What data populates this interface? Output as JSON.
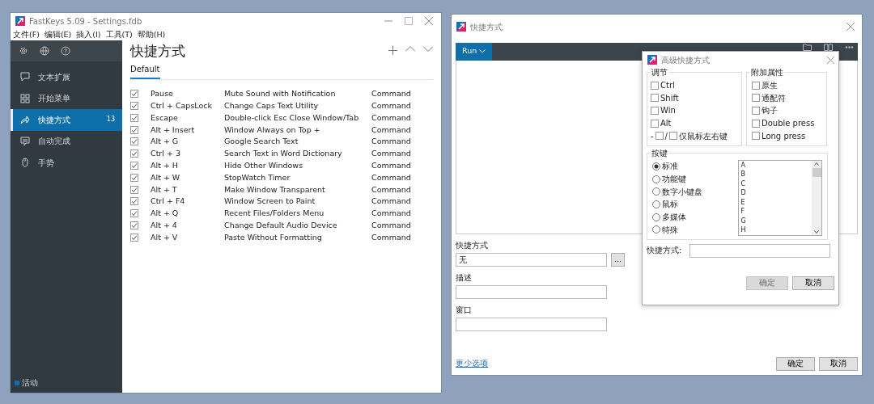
{
  "main_window": {
    "title": "FastKeys 5.09  - Settings.fdb",
    "menu": [
      "文件(F)",
      "编辑(E)",
      "插入(I)",
      "工具(T)",
      "帮助(H)"
    ],
    "sidebar": {
      "items": [
        {
          "kind": "expand",
          "label": "文本扩展",
          "selected": false
        },
        {
          "kind": "menu",
          "label": "开始菜单",
          "selected": false
        },
        {
          "kind": "shortcut",
          "label": "快捷方式",
          "selected": true,
          "count": "13"
        },
        {
          "kind": "complete",
          "label": "自动完成",
          "selected": false
        },
        {
          "kind": "gesture",
          "label": "手势",
          "selected": false
        }
      ],
      "status": "活动"
    },
    "content": {
      "heading": "快捷方式",
      "tabs": [
        {
          "label": "Default",
          "selected": true
        }
      ],
      "rows": [
        {
          "checked": true,
          "shortcut": "Pause",
          "action": "Mute Sound with Notification",
          "type": "Command"
        },
        {
          "checked": true,
          "shortcut": "Ctrl + CapsLock",
          "action": "Change Caps Text Utility",
          "type": "Command"
        },
        {
          "checked": true,
          "shortcut": "Escape",
          "action": "Double-click Esc Close Window/Tab",
          "type": "Command"
        },
        {
          "checked": true,
          "shortcut": "Alt + Insert",
          "action": "Window Always on Top +",
          "type": "Command"
        },
        {
          "checked": true,
          "shortcut": "Alt + G",
          "action": "Google Search Text",
          "type": "Command"
        },
        {
          "checked": true,
          "shortcut": "Ctrl + 3",
          "action": "Search Text in Word Dictionary",
          "type": "Command"
        },
        {
          "checked": true,
          "shortcut": "Alt + H",
          "action": "Hide Other Windows",
          "type": "Command"
        },
        {
          "checked": true,
          "shortcut": "Alt + W",
          "action": "StopWatch Timer",
          "type": "Command"
        },
        {
          "checked": true,
          "shortcut": "Alt + T",
          "action": "Make Window Transparent",
          "type": "Command"
        },
        {
          "checked": true,
          "shortcut": "Ctrl + F4",
          "action": "Window Screen to Paint",
          "type": "Command"
        },
        {
          "checked": true,
          "shortcut": "Alt + Q",
          "action": "Recent Files/Folders Menu",
          "type": "Command"
        },
        {
          "checked": true,
          "shortcut": "Alt + 4",
          "action": "Change Default Audio Device",
          "type": "Command"
        },
        {
          "checked": true,
          "shortcut": "Alt + V",
          "action": "Paste Without Formatting",
          "type": "Command"
        }
      ]
    }
  },
  "editor_window": {
    "title": "快捷方式",
    "run_button": "Run",
    "shortcut_label": "快捷方式",
    "shortcut_value": "无",
    "browse_button": "...",
    "description_label": "描述",
    "window_label": "窗口",
    "less_link": "更少选项",
    "ok_button": "确定",
    "cancel_button": "取消"
  },
  "dialog": {
    "title": "高级快捷方式",
    "modifiers_title": "调节",
    "modifiers": [
      {
        "label": "Ctrl",
        "checked": false
      },
      {
        "label": "Shift",
        "checked": false
      },
      {
        "label": "Win",
        "checked": false
      },
      {
        "label": "Alt",
        "checked": false
      }
    ],
    "mouse_option": {
      "dash": "-",
      "left_checked": false,
      "slash": "/",
      "right_checked": false,
      "label": "仅鼠标左右键"
    },
    "extras_title": "附加属性",
    "extras": [
      {
        "label": "原生",
        "checked": false
      },
      {
        "label": "通配符",
        "checked": false
      },
      {
        "label": "钩子",
        "checked": false
      },
      {
        "label": "Double press",
        "checked": false
      },
      {
        "label": "Long press",
        "checked": false
      }
    ],
    "keys_title": "按键",
    "key_types": [
      {
        "label": "标准",
        "selected": true
      },
      {
        "label": "功能键",
        "selected": false
      },
      {
        "label": "数字小键盘",
        "selected": false
      },
      {
        "label": "鼠标",
        "selected": false
      },
      {
        "label": "多媒体",
        "selected": false
      },
      {
        "label": "特殊",
        "selected": false
      }
    ],
    "keys": [
      "A",
      "B",
      "C",
      "D",
      "E",
      "F",
      "G",
      "H"
    ],
    "shortcut_label": "快捷方式:",
    "ok_button": "确定",
    "ok_disabled": true,
    "cancel_button": "取消"
  }
}
